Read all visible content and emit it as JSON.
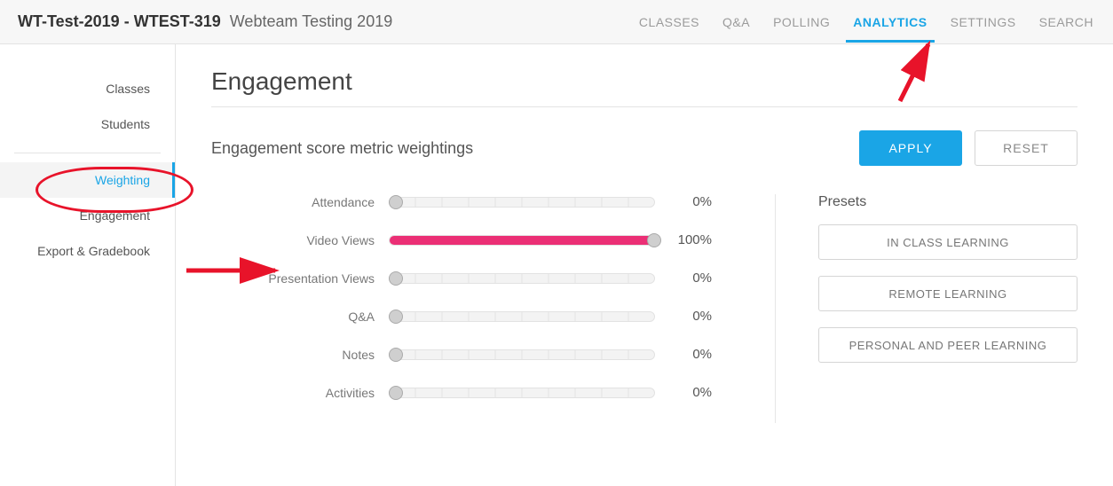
{
  "breadcrumb": {
    "course_code": "WT-Test-2019",
    "sep": " - ",
    "section_code": "WTEST-319",
    "course_name": "Webteam Testing 2019"
  },
  "topnav": {
    "items": [
      {
        "label": "CLASSES",
        "active": false
      },
      {
        "label": "Q&A",
        "active": false
      },
      {
        "label": "POLLING",
        "active": false
      },
      {
        "label": "ANALYTICS",
        "active": true
      },
      {
        "label": "SETTINGS",
        "active": false
      },
      {
        "label": "SEARCH",
        "active": false
      }
    ]
  },
  "sidebar": {
    "group1": [
      {
        "label": "Classes"
      },
      {
        "label": "Students"
      }
    ],
    "group2": [
      {
        "label": "Weighting",
        "active": true
      },
      {
        "label": "Engagement"
      },
      {
        "label": "Export & Gradebook"
      }
    ]
  },
  "page": {
    "title": "Engagement",
    "subtitle": "Engagement score metric weightings"
  },
  "buttons": {
    "apply": "APPLY",
    "reset": "RESET"
  },
  "metrics": [
    {
      "name": "Attendance",
      "value": 0
    },
    {
      "name": "Video Views",
      "value": 100
    },
    {
      "name": "Presentation Views",
      "value": 0
    },
    {
      "name": "Q&A",
      "value": 0
    },
    {
      "name": "Notes",
      "value": 0
    },
    {
      "name": "Activities",
      "value": 0
    }
  ],
  "presets": {
    "title": "Presets",
    "options": [
      "IN CLASS LEARNING",
      "REMOTE LEARNING",
      "PERSONAL AND PEER LEARNING"
    ]
  }
}
